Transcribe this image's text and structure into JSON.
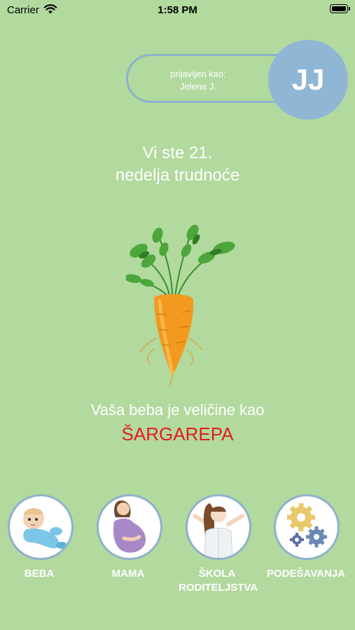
{
  "status_bar": {
    "carrier": "Carrier",
    "time": "1:58 PM"
  },
  "login": {
    "logged_in_as": "prijavljen kao:",
    "user_name": "Jelena J.",
    "initials": "JJ"
  },
  "pregnancy": {
    "week_line1": "Vi ste 21.",
    "week_line2": "nedelja trudnoće",
    "size_caption": "Vaša beba je veličine kao",
    "fruit": "ŠARGAREPA"
  },
  "nav": [
    {
      "label": "BEBA",
      "icon": "baby-icon"
    },
    {
      "label": "MAMA",
      "icon": "pregnant-mother-icon"
    },
    {
      "label_line1": "ŠKOLA",
      "label_line2": "RODITELJSTVA",
      "icon": "parenting-school-icon"
    },
    {
      "label": "PODEŠAVANJA",
      "icon": "gears-icon"
    }
  ],
  "colors": {
    "background": "#b2d99e",
    "accent_blue": "#8fb6d5",
    "fruit_red": "#e31d1d"
  }
}
